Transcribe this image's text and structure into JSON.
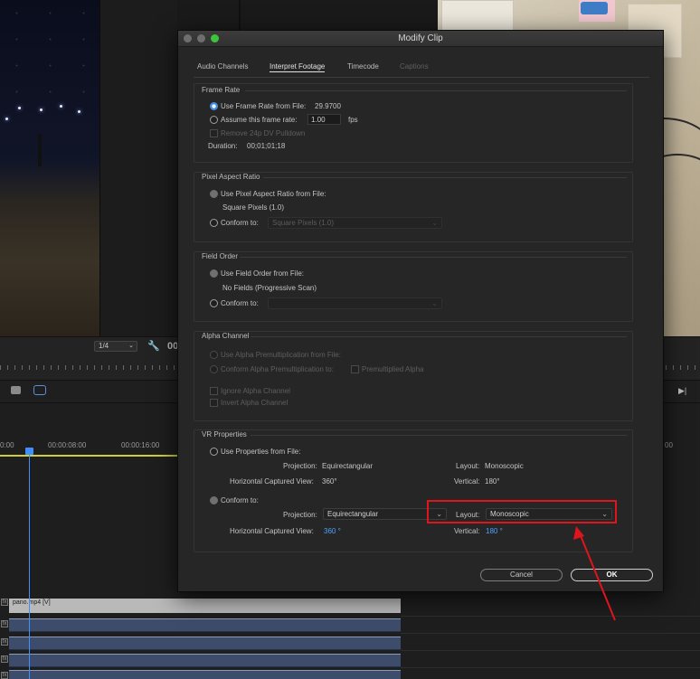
{
  "background": {
    "resolution": "1/4",
    "timecode_partial": "00",
    "timeline_times": [
      "0:00",
      "00:00:08:00",
      "00:00:16:00",
      "00"
    ],
    "clip_label": "pano.mp4 [V]",
    "fx_badge": "fx"
  },
  "dialog": {
    "title": "Modify Clip",
    "tabs": [
      {
        "label": "Audio Channels",
        "state": "normal"
      },
      {
        "label": "Interpret Footage",
        "state": "active"
      },
      {
        "label": "Timecode",
        "state": "normal"
      },
      {
        "label": "Captions",
        "state": "disabled"
      }
    ],
    "frame_rate": {
      "title": "Frame Rate",
      "use_file_label": "Use Frame Rate from File:",
      "use_file_value": "29.9700",
      "assume_label": "Assume this frame rate:",
      "assume_value": "1.00",
      "assume_unit": "fps",
      "pulldown_label": "Remove 24p DV Pulldown",
      "duration_label": "Duration:",
      "duration_value": "00;01;01;18"
    },
    "pixel_aspect": {
      "title": "Pixel Aspect Ratio",
      "use_file_label": "Use Pixel Aspect Ratio from File:",
      "file_value": "Square Pixels (1.0)",
      "conform_label": "Conform to:",
      "conform_value": "Square Pixels (1.0)"
    },
    "field_order": {
      "title": "Field Order",
      "use_file_label": "Use Field Order from File:",
      "file_value": "No Fields (Progressive Scan)",
      "conform_label": "Conform to:",
      "conform_value": ""
    },
    "alpha_channel": {
      "title": "Alpha Channel",
      "use_premult_label": "Use Alpha Premultiplication from File:",
      "conform_premult_label": "Conform Alpha Premultiplication to:",
      "premultiplied_label": "Premultiplied Alpha",
      "ignore_label": "Ignore Alpha Channel",
      "invert_label": "Invert Alpha Channel"
    },
    "vr": {
      "title": "VR Properties",
      "use_file_label": "Use Properties from File:",
      "projection_label": "Projection:",
      "file_projection": "Equirectangular",
      "layout_label": "Layout:",
      "file_layout": "Monoscopic",
      "hcv_label": "Horizontal Captured View:",
      "file_hcv": "360°",
      "vertical_label": "Vertical:",
      "file_vertical": "180°",
      "conform_label": "Conform to:",
      "conform_projection": "Equirectangular",
      "conform_layout": "Monoscopic",
      "conform_hcv": "360 °",
      "conform_vertical": "180 °"
    },
    "buttons": {
      "cancel": "Cancel",
      "ok": "OK"
    }
  },
  "colors": {
    "accent_blue": "#4ea0ff",
    "highlight_red": "#e0141b",
    "dialog_bg": "#262626"
  }
}
